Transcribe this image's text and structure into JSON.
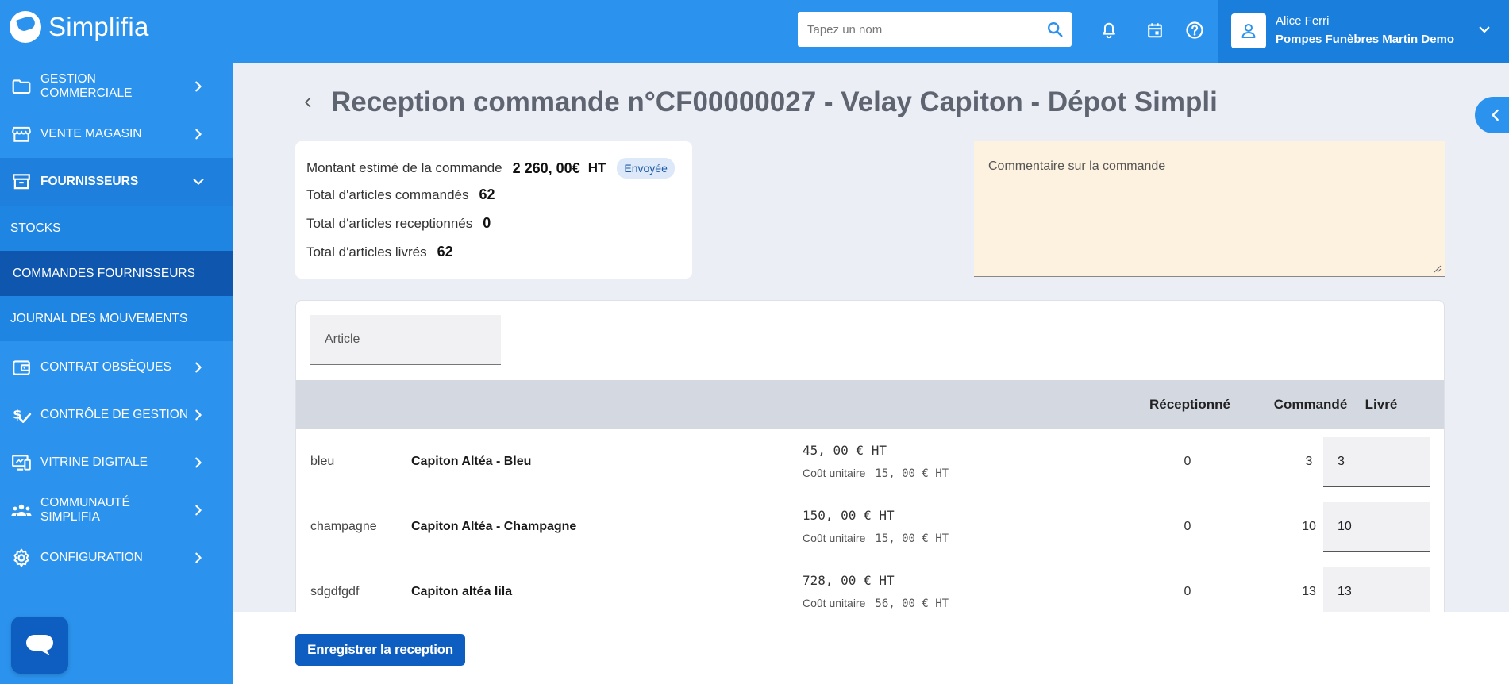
{
  "app": {
    "name": "Simplifia"
  },
  "header": {
    "search_placeholder": "Tapez un nom",
    "user_name": "Alice Ferri",
    "user_org": "Pompes Funèbres Martin Demo"
  },
  "sidebar": {
    "items": [
      {
        "label": "GESTION COMMERCIALE",
        "icon": "folder-icon"
      },
      {
        "label": "VENTE MAGASIN",
        "icon": "store-icon"
      },
      {
        "label": "FOURNISSEURS",
        "icon": "archive-icon"
      },
      {
        "label": "CONTRAT OBSÈQUES",
        "icon": "wallet-icon"
      },
      {
        "label": "CONTRÔLE DE GESTION",
        "icon": "finance-check-icon"
      },
      {
        "label": "VITRINE DIGITALE",
        "icon": "screen-icon"
      },
      {
        "label": "COMMUNAUTÉ SIMPLIFIA",
        "icon": "group-icon"
      },
      {
        "label": "CONFIGURATION",
        "icon": "gear-icon"
      }
    ],
    "subitems": [
      {
        "label": "STOCKS"
      },
      {
        "label": "COMMANDES FOURNISSEURS"
      },
      {
        "label": "JOURNAL DES MOUVEMENTS"
      }
    ]
  },
  "page": {
    "title": "Reception commande n°CF00000027 - Velay Capiton - Dépot Simpli"
  },
  "summary": {
    "amount_label": "Montant estimé de la commande",
    "amount_value": "2 260, 00€",
    "amount_unit": "HT",
    "status_badge": "Envoyée",
    "ordered_label": "Total d'articles commandés",
    "ordered_value": "62",
    "received_label": "Total d'articles receptionnés",
    "received_value": "0",
    "delivered_label": "Total d'articles livrés",
    "delivered_value": "62"
  },
  "comment": {
    "placeholder": "Commentaire sur la commande"
  },
  "table": {
    "filter_placeholder": "Article",
    "headers": {
      "received": "Réceptionné",
      "ordered": "Commandé",
      "delivered": "Livré"
    },
    "unit_cost_label": "Coût unitaire",
    "rows": [
      {
        "ref": "bleu",
        "name": "Capiton Altéa - Bleu",
        "price": "45, 00 € HT",
        "unit_cost": "15, 00 € HT",
        "received": "0",
        "ordered": "3",
        "delivered": "3"
      },
      {
        "ref": "champagne",
        "name": "Capiton Altéa - Champagne",
        "price": "150, 00 € HT",
        "unit_cost": "15, 00 € HT",
        "received": "0",
        "ordered": "10",
        "delivered": "10"
      },
      {
        "ref": "sdgdfgdf",
        "name": "Capiton altéa lila",
        "price": "728, 00 € HT",
        "unit_cost": "56, 00 € HT",
        "received": "0",
        "ordered": "13",
        "delivered": "13"
      }
    ]
  },
  "footer": {
    "save_label": "Enregistrer la reception"
  },
  "colors": {
    "primary": "#2b93ee",
    "dark_blue": "#0e5dc1",
    "comment_bg": "#fdf1df"
  }
}
